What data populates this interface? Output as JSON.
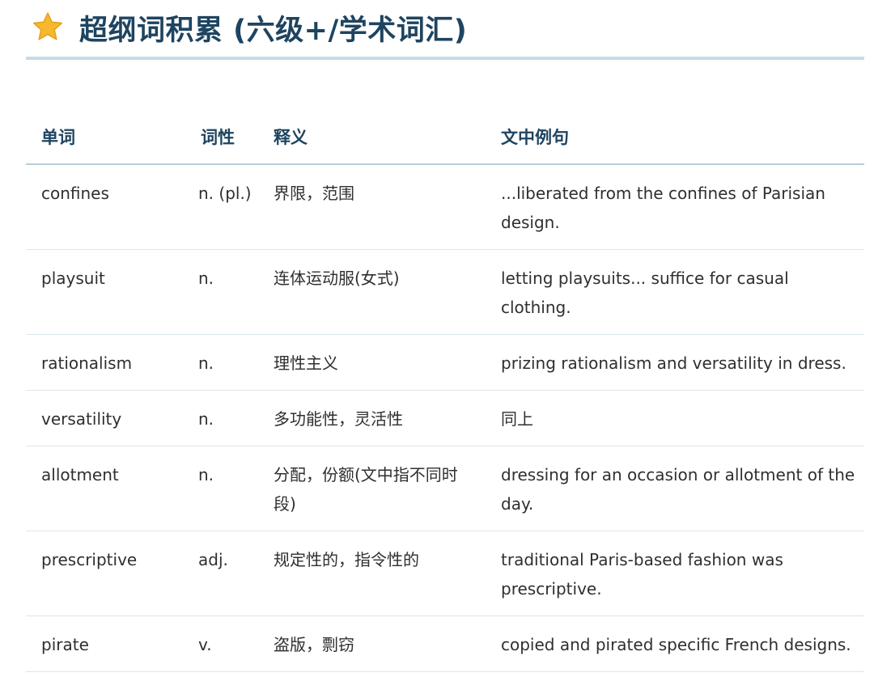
{
  "header": {
    "title": "超纲词积累 (六级+/学术词汇)",
    "icon": "star-icon",
    "icon_color": "#f5b82e"
  },
  "table": {
    "columns": [
      "单词",
      "词性",
      "释义",
      "文中例句"
    ],
    "rows": [
      {
        "word": "confines",
        "pos": "n. (pl.)",
        "definition": "界限，范围",
        "example": "...liberated from the confines of Parisian design."
      },
      {
        "word": "playsuit",
        "pos": "n.",
        "definition": "连体运动服(女式)",
        "example": "letting playsuits... suffice for casual clothing."
      },
      {
        "word": "rationalism",
        "pos": "n.",
        "definition": "理性主义",
        "example": "prizing rationalism and versatility in dress."
      },
      {
        "word": "versatility",
        "pos": "n.",
        "definition": "多功能性，灵活性",
        "example": "同上"
      },
      {
        "word": "allotment",
        "pos": "n.",
        "definition": "分配，份额(文中指不同时段)",
        "example": "dressing for an occasion or allotment of the day."
      },
      {
        "word": "prescriptive",
        "pos": "adj.",
        "definition": "规定性的，指令性的",
        "example": "traditional Paris-based fashion was prescriptive."
      },
      {
        "word": "pirate",
        "pos": "v.",
        "definition": "盗版，剽窃",
        "example": "copied and pirated specific French designs."
      }
    ]
  },
  "colors": {
    "title": "#1e4460",
    "rule": "#c9dbe6",
    "row_divider": "#dbe6ec"
  }
}
